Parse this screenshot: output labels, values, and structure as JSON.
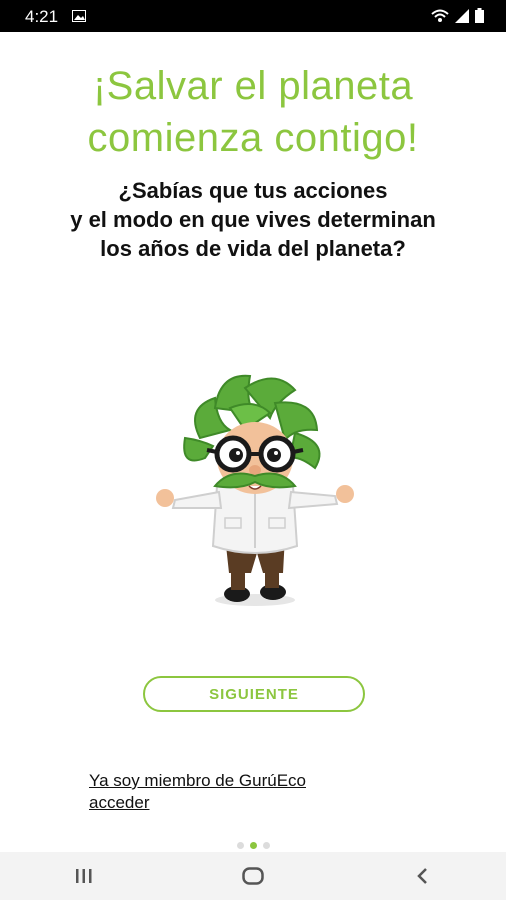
{
  "status_bar": {
    "time": "4:21",
    "icons": [
      "image-icon",
      "wifi-icon",
      "signal-icon",
      "battery-icon"
    ]
  },
  "headline": {
    "line1": "¡Salvar el planeta",
    "line2": "comienza contigo!"
  },
  "subtitle": {
    "line1": "¿Sabías que tus acciones",
    "line2": "y el modo en que vives determinan",
    "line3": "los años de vida del planeta?"
  },
  "mascot": {
    "icon": "eco-guru-mascot"
  },
  "next_button": {
    "label": "SIGUIENTE"
  },
  "login_link": {
    "line1": "Ya soy miembro de GurúEco",
    "line2": "acceder"
  },
  "pager": {
    "total": 3,
    "active": 1
  },
  "colors": {
    "brand_green": "#8cc63f",
    "text_dark": "#111111"
  },
  "nav_bar": {
    "icons": [
      "recents-icon",
      "home-icon",
      "back-icon"
    ]
  }
}
